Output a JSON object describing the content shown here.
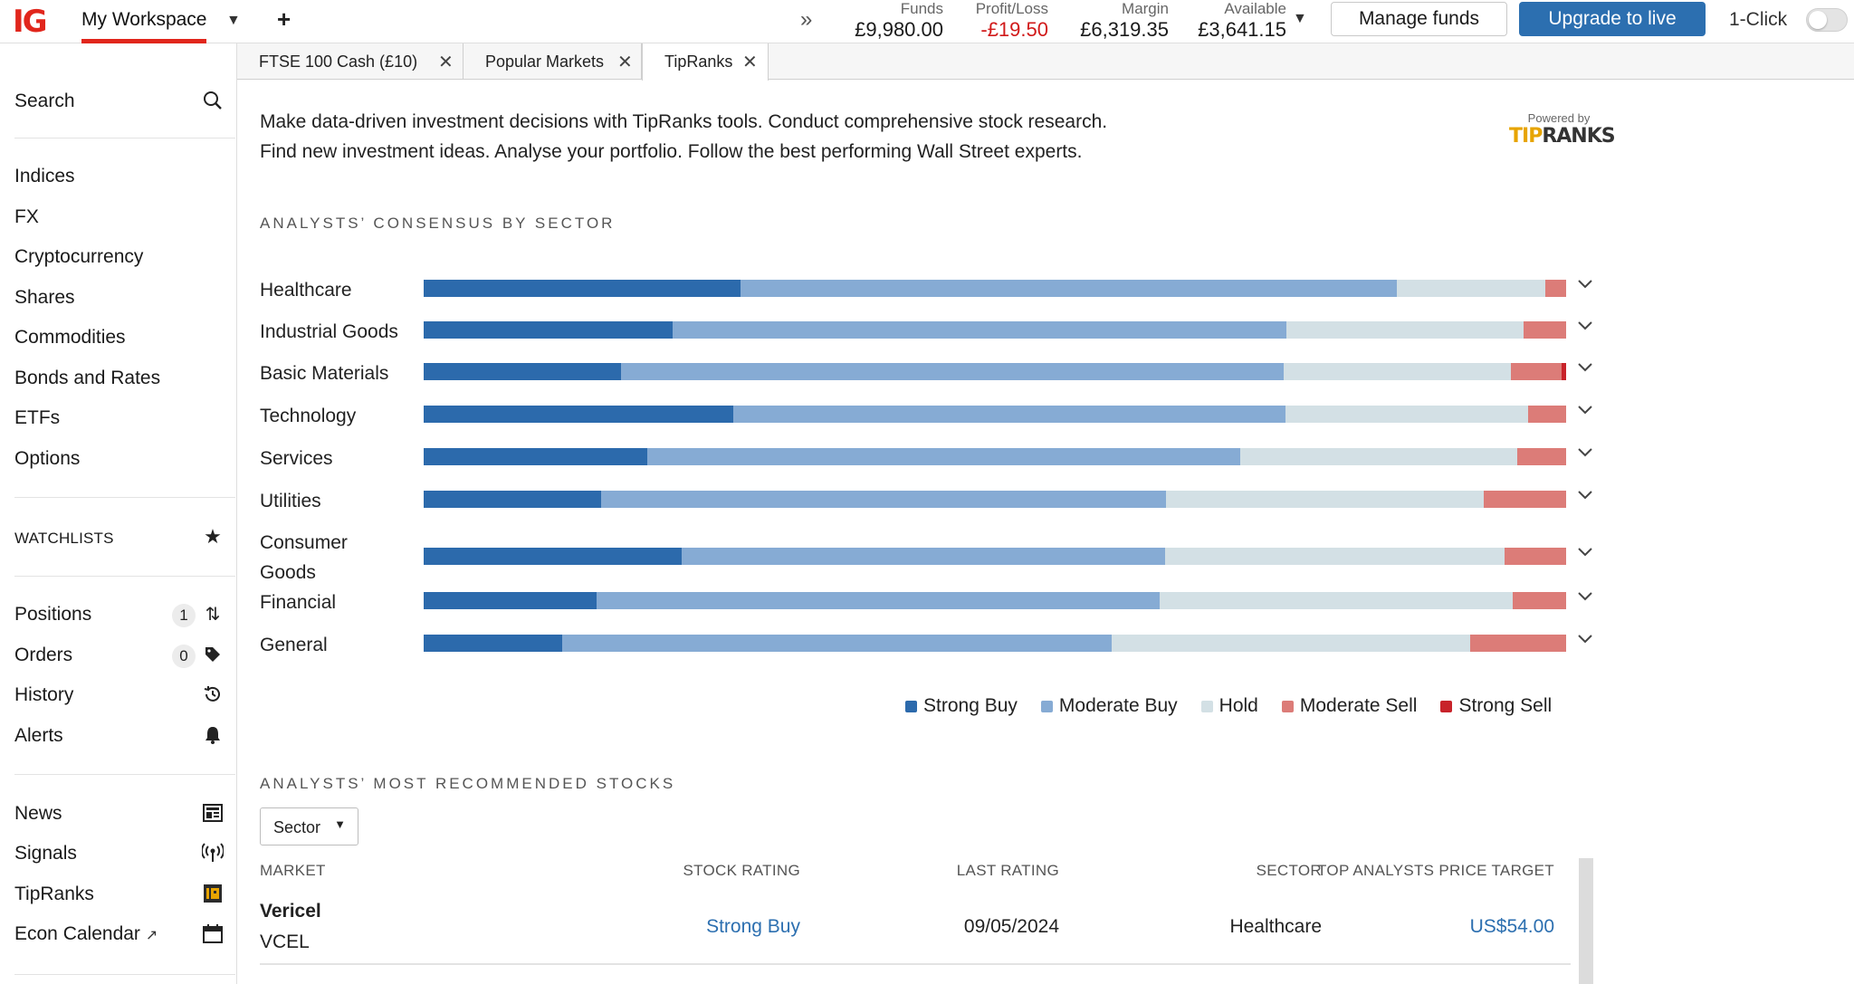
{
  "topbar": {
    "logo": "IG",
    "workspace": "My Workspace",
    "add": "+",
    "expand_icon": "double-chevron-right-icon",
    "stats": [
      {
        "label": "Funds",
        "value": "£9,980.00",
        "negative": false
      },
      {
        "label": "Profit/Loss",
        "value": "-£19.50",
        "negative": true
      },
      {
        "label": "Margin",
        "value": "£6,319.35",
        "negative": false
      },
      {
        "label": "Available",
        "value": "£3,641.15",
        "negative": false
      }
    ],
    "manage_funds": "Manage funds",
    "upgrade": "Upgrade to live",
    "one_click": "1-Click",
    "one_click_on": false
  },
  "sidebar": {
    "search": "Search",
    "markets": [
      "Indices",
      "FX",
      "Cryptocurrency",
      "Shares",
      "Commodities",
      "Bonds and Rates",
      "ETFs",
      "Options"
    ],
    "watchlists": "WATCHLISTS",
    "activity": [
      {
        "label": "Positions",
        "count": "1",
        "icon": "swap-arrows-icon"
      },
      {
        "label": "Orders",
        "count": "0",
        "icon": "tag-icon"
      },
      {
        "label": "History",
        "count": null,
        "icon": "history-icon"
      },
      {
        "label": "Alerts",
        "count": null,
        "icon": "bell-icon"
      }
    ],
    "tools": [
      {
        "label": "News",
        "icon": "newspaper-icon"
      },
      {
        "label": "Signals",
        "icon": "broadcast-icon"
      },
      {
        "label": "TipRanks",
        "icon": "tipranks-icon"
      },
      {
        "label": "Econ Calendar",
        "icon": "calendar-icon"
      }
    ]
  },
  "tabs": [
    {
      "label": "FTSE 100 Cash (£10)",
      "active": false
    },
    {
      "label": "Popular Markets",
      "active": false
    },
    {
      "label": "TipRanks",
      "active": true
    }
  ],
  "main": {
    "intro_line1": "Make data-driven investment decisions with TipRanks tools. Conduct comprehensive stock research.",
    "intro_line2": "Find new investment ideas. Analyse your portfolio. Follow the best performing Wall Street experts.",
    "powered_by": "Powered by",
    "brand_tip": "TIP",
    "brand_ranks": "RANKS",
    "consensus_title": "ANALYSTS’ CONSENSUS BY SECTOR",
    "recommended_title": "ANALYSTS’ MOST RECOMMENDED STOCKS",
    "sector_filter": "Sector",
    "table_headers": {
      "market": "MARKET",
      "rating": "STOCK RATING",
      "last": "LAST RATING",
      "sector": "SECTOR",
      "target": "TOP ANALYSTS PRICE TARGET"
    },
    "rows": [
      {
        "name": "Vericel",
        "ticker": "VCEL",
        "rating": "Strong Buy",
        "last": "09/05/2024",
        "sector": "Healthcare",
        "target": "US$54.00"
      }
    ]
  },
  "chart_data": {
    "type": "bar",
    "stacked": true,
    "orientation": "horizontal",
    "title": "ANALYSTS’ CONSENSUS BY SECTOR",
    "categories": [
      "Healthcare",
      "Industrial Goods",
      "Basic Materials",
      "Technology",
      "Services",
      "Utilities",
      "Consumer Goods",
      "Financial",
      "General"
    ],
    "series": [
      {
        "name": "Strong Buy",
        "color": "#2c6aac",
        "values": [
          27.7,
          21.8,
          17.3,
          27.1,
          19.6,
          15.5,
          22.6,
          15.1,
          12.2
        ]
      },
      {
        "name": "Moderate Buy",
        "color": "#86abd4",
        "values": [
          57.5,
          53.7,
          58.0,
          48.3,
          51.9,
          49.5,
          42.3,
          49.3,
          48.3
        ]
      },
      {
        "name": "Hold",
        "color": "#d3e0e5",
        "values": [
          13.0,
          20.8,
          19.9,
          21.3,
          24.2,
          27.8,
          29.7,
          30.9,
          31.5
        ]
      },
      {
        "name": "Moderate Sell",
        "color": "#dc7c78",
        "values": [
          1.8,
          3.7,
          4.4,
          3.3,
          4.3,
          7.2,
          5.4,
          4.7,
          8.4
        ]
      },
      {
        "name": "Strong Sell",
        "color": "#c8232a",
        "values": [
          0.0,
          0.0,
          0.4,
          0.0,
          0.0,
          0.0,
          0.0,
          0.0,
          0.0
        ]
      }
    ],
    "xlim": [
      0,
      100
    ],
    "legend": "bottom-right"
  }
}
